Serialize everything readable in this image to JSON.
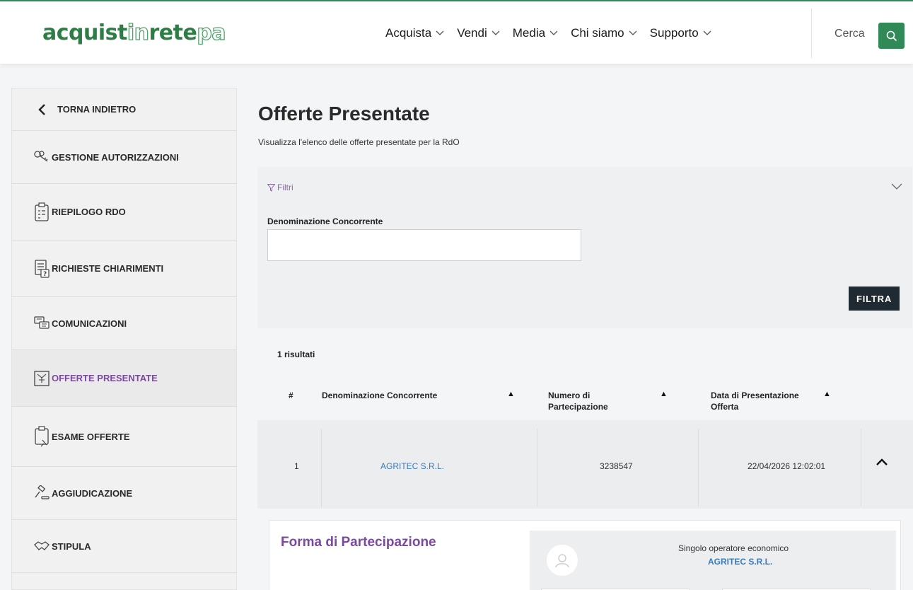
{
  "header": {
    "logo_part1": "acquist",
    "logo_part2": "in",
    "logo_part3": "rete",
    "logo_part4": "pa",
    "nav": [
      {
        "label": "Acquista"
      },
      {
        "label": "Vendi"
      },
      {
        "label": "Media"
      },
      {
        "label": "Chi siamo"
      },
      {
        "label": "Supporto"
      }
    ],
    "search_label": "Cerca"
  },
  "sidebar": {
    "items": [
      {
        "label": "TORNA INDIETRO",
        "icon": "chevron-left-icon"
      },
      {
        "label": "GESTIONE AUTORIZZAZIONI",
        "icon": "keys-icon"
      },
      {
        "label": "RIEPILOGO RDO",
        "icon": "clipboard-icon"
      },
      {
        "label": "RICHIESTE CHIARIMENTI",
        "icon": "document-question-icon"
      },
      {
        "label": "COMUNICAZIONI",
        "icon": "chat-icon"
      },
      {
        "label": "OFFERTE PRESENTATE",
        "icon": "offer-icon"
      },
      {
        "label": "ESAME OFFERTE",
        "icon": "review-icon"
      },
      {
        "label": "AGGIUDICAZIONE",
        "icon": "gavel-icon"
      },
      {
        "label": "STIPULA",
        "icon": "handshake-icon"
      }
    ]
  },
  "main": {
    "title": "Offerte Presentate",
    "subtitle": "Visualizza l'elenco delle offerte presentate per la RdO",
    "filter": {
      "toggle_label": "Filtri",
      "field_label": "Denominazione Concorrente",
      "field_value": "",
      "field_placeholder": "",
      "button_label": "FILTRA"
    },
    "results_count": "1 risultati",
    "table": {
      "headers": [
        "#",
        "Denominazione Concorrente",
        "Numero di Partecipazione",
        "Data di Presentazione Offerta"
      ],
      "rows": [
        {
          "index": "1",
          "name": "AGRITEC S.R.L.",
          "number": "3238547",
          "date": "22/04/2026 12:02:01"
        }
      ]
    },
    "detail": {
      "title": "Forma di Partecipazione",
      "operator_type": "Singolo operatore economico",
      "operator_name": "AGRITEC S.R.L."
    }
  },
  "colors": {
    "brand_green": "#2f8a57",
    "accent_purple": "#7a4aa0",
    "link_blue": "#3a7bc2",
    "button_dark": "#1f2a33"
  }
}
